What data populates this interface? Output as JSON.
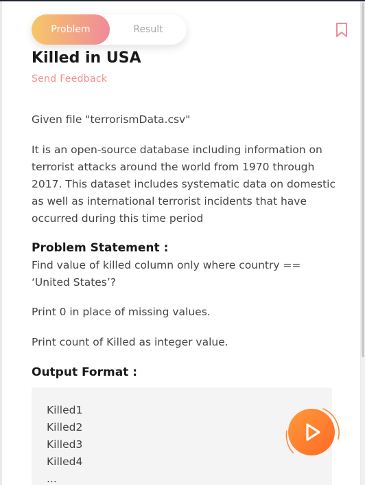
{
  "tabs": {
    "problem": "Problem",
    "result": "Result"
  },
  "problem": {
    "title": "Killed in USA",
    "feedback": "Send Feedback",
    "given_file": "Given file \"terrorismData.csv\"",
    "description": "It is an open-source database including information on terrorist attacks around the world from 1970 through 2017. This dataset includes systematic data on domestic as well as international terrorist incidents that have occurred during this time period",
    "statement_heading": "Problem Statement :",
    "statement": "Find value of killed column only where country == ‘United States’?",
    "note_missing": "Print 0 in place of missing values.",
    "note_count": "Print count of Killed as integer value.",
    "output_heading": "Output Format :",
    "output_lines": [
      "Killed1",
      "Killed2",
      "Killed3",
      "Killed4",
      "..."
    ]
  },
  "icons": {
    "bookmark": "bookmark-icon",
    "run": "play-icon"
  },
  "colors": {
    "accent_start": "#f6c768",
    "accent_end": "#f08a9a",
    "feedback": "#f0918c",
    "run": "#ff7a2e"
  }
}
